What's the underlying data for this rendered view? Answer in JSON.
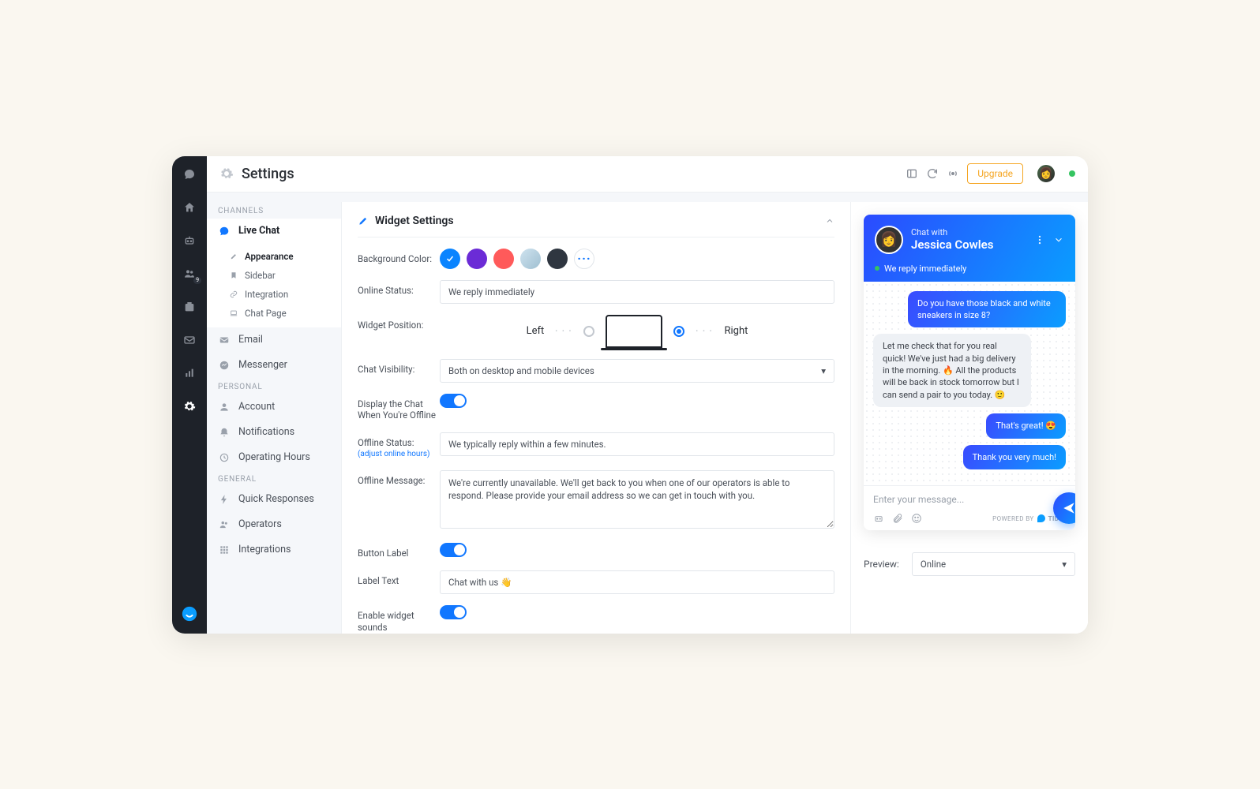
{
  "header": {
    "title": "Settings",
    "upgrade": "Upgrade"
  },
  "nav_rail": {
    "badge": "9",
    "items": [
      "chat",
      "home",
      "bot",
      "users",
      "inbox",
      "mail",
      "stats",
      "settings"
    ]
  },
  "sidebar": {
    "groups": [
      {
        "label": "CHANNELS"
      },
      {
        "label": "PERSONAL"
      },
      {
        "label": "GENERAL"
      }
    ],
    "livechat": {
      "label": "Live Chat",
      "sub": [
        {
          "label": "Appearance"
        },
        {
          "label": "Sidebar"
        },
        {
          "label": "Integration"
        },
        {
          "label": "Chat Page"
        }
      ]
    },
    "items": {
      "email": "Email",
      "messenger": "Messenger",
      "account": "Account",
      "notifications": "Notifications",
      "hours": "Operating Hours",
      "quick": "Quick Responses",
      "operators": "Operators",
      "integrations": "Integrations"
    }
  },
  "panel": {
    "title": "Widget Settings"
  },
  "form": {
    "bg_label": "Background Color:",
    "swatches": [
      "#0a84ff",
      "#6b2bd6",
      "#ff5a5a",
      "#bdd6e6",
      "#2f3640"
    ],
    "more": "···",
    "online_status_label": "Online Status:",
    "online_status_value": "We reply immediately",
    "position_label": "Widget Position:",
    "position_left": "Left",
    "position_right": "Right",
    "visibility_label": "Chat Visibility:",
    "visibility_value": "Both on desktop and mobile devices",
    "offline_display_label": "Display the Chat When You're Offline",
    "offline_status_label": "Offline Status:",
    "offline_status_hint": "(adjust online hours)",
    "offline_status_value": "We typically reply within a few minutes.",
    "offline_msg_label": "Offline Message:",
    "offline_msg_value": "We're currently unavailable. We'll get back to you when one of our operators is able to respond. Please provide your email address so we can get in touch with you.",
    "buttonlabel_label": "Button Label",
    "labeltext_label": "Label Text",
    "labeltext_value": "Chat with us 👋",
    "sounds_label": "Enable widget sounds"
  },
  "preview": {
    "chat_with": "Chat with",
    "agent": "Jessica Cowles",
    "status": "We reply immediately",
    "msgs": [
      {
        "side": "user",
        "text": "Do you have those black and white sneakers in size 8?"
      },
      {
        "side": "agent",
        "text": "Let me check that for you real quick! We've just had a big delivery in the morning. 🔥 All the products will be back in stock tomorrow but I can send a pair to you today. 🙂"
      },
      {
        "side": "user",
        "text": "That's great! 😍"
      },
      {
        "side": "user",
        "text": "Thank you very much!"
      }
    ],
    "placeholder": "Enter your message...",
    "powered": "POWERED BY",
    "brand": "TIDIO",
    "row_label": "Preview:",
    "row_value": "Online"
  }
}
